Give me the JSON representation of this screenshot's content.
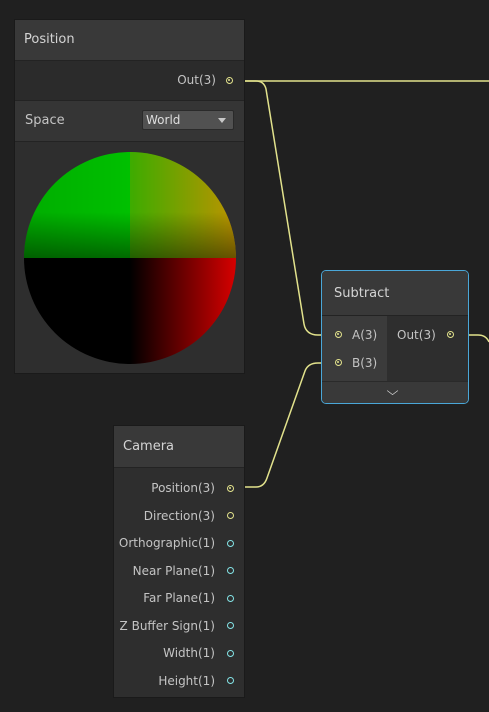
{
  "colors": {
    "background": "#202020",
    "node_body": "#2e2e2e",
    "node_header": "#393939",
    "selection_outline": "#4aa7d8",
    "vector3_port": "#e2e28c",
    "vector1_port": "#84e4e7"
  },
  "position_node": {
    "title": "Position",
    "output_label": "Out(3)",
    "space_label": "Space",
    "space_value": "World",
    "preview": "sphere-preview"
  },
  "subtract_node": {
    "title": "Subtract",
    "inputs": [
      "A(3)",
      "B(3)"
    ],
    "output_label": "Out(3)",
    "collapse_icon": "chevron-down-icon"
  },
  "camera_node": {
    "title": "Camera",
    "outputs": [
      {
        "label": "Position(3)",
        "type": "vector3",
        "connected": true
      },
      {
        "label": "Direction(3)",
        "type": "vector3",
        "connected": false
      },
      {
        "label": "Orthographic(1)",
        "type": "vector1",
        "connected": false
      },
      {
        "label": "Near Plane(1)",
        "type": "vector1",
        "connected": false
      },
      {
        "label": "Far Plane(1)",
        "type": "vector1",
        "connected": false
      },
      {
        "label": "Z Buffer Sign(1)",
        "type": "vector1",
        "connected": false
      },
      {
        "label": "Width(1)",
        "type": "vector1",
        "connected": false
      },
      {
        "label": "Height(1)",
        "type": "vector1",
        "connected": false
      }
    ]
  }
}
